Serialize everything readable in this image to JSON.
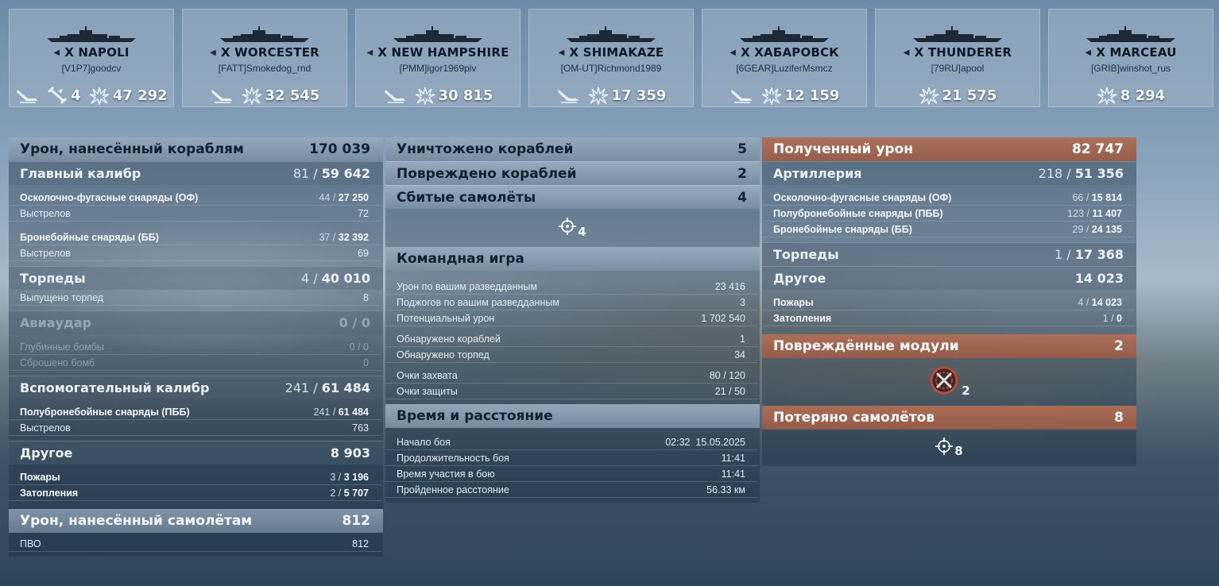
{
  "ships": [
    {
      "name": "X NAPOLI",
      "player": "[V1P7]goodcv",
      "stats": [
        {
          "icon": "torpedo-hit-icon",
          "value": ""
        },
        {
          "icon": "aircraft-kill-icon",
          "value": "4"
        },
        {
          "icon": "damage-icon",
          "value": "47 292"
        }
      ]
    },
    {
      "name": "X WORCESTER",
      "player": "[FATT]Smokedog_rnd",
      "stats": [
        {
          "icon": "torpedo-hit-icon",
          "value": ""
        },
        {
          "icon": "damage-icon",
          "value": "32 545"
        }
      ]
    },
    {
      "name": "X NEW HAMPSHIRE",
      "player": "[PMM]igor1969piv",
      "stats": [
        {
          "icon": "torpedo-hit-icon",
          "value": ""
        },
        {
          "icon": "damage-icon",
          "value": "30 815"
        }
      ]
    },
    {
      "name": "X SHIMAKAZE",
      "player": "[OM-UT]Richmond1989",
      "stats": [
        {
          "icon": "torpedo-hit-icon",
          "value": ""
        },
        {
          "icon": "damage-icon",
          "value": "17 359"
        }
      ]
    },
    {
      "name": "X ХАБАРОВСК",
      "player": "[6GEAR]LuziferMsmcz",
      "stats": [
        {
          "icon": "torpedo-hit-icon",
          "value": ""
        },
        {
          "icon": "damage-icon",
          "value": "12 159"
        }
      ]
    },
    {
      "name": "X THUNDERER",
      "player": "[79RU]apool",
      "stats": [
        {
          "icon": "damage-icon",
          "value": "21 575"
        }
      ]
    },
    {
      "name": "X MARCEAU",
      "player": "[GRIB]winshot_rus",
      "stats": [
        {
          "icon": "damage-icon",
          "value": "8 294"
        }
      ]
    }
  ],
  "left": {
    "damage_header": {
      "label": "Урон, нанесённый кораблям",
      "value": "170 039"
    },
    "main_battery": {
      "label": "Главный калибр",
      "hits": "81",
      "dmg": "59 642"
    },
    "he": {
      "label": "Осколочно-фугасные снаряды (ОФ)",
      "hits": "44",
      "dmg": "27 250"
    },
    "he_shots": {
      "label": "Выстрелов",
      "value": "72"
    },
    "ap": {
      "label": "Бронебойные снаряды (ББ)",
      "hits": "37",
      "dmg": "32 392"
    },
    "ap_shots": {
      "label": "Выстрелов",
      "value": "69"
    },
    "torpedoes": {
      "label": "Торпеды",
      "hits": "4",
      "dmg": "40 010"
    },
    "torp_launched": {
      "label": "Выпущено торпед",
      "value": "8"
    },
    "airstrike": {
      "label": "Авиаудар",
      "value": "0 / 0"
    },
    "depth": {
      "label": "Глубинные бомбы",
      "value": "0 / 0"
    },
    "bombs": {
      "label": "Сброшено бомб",
      "value": "0"
    },
    "secondary": {
      "label": "Вспомогательный калибр",
      "hits": "241",
      "dmg": "61 484"
    },
    "sap": {
      "label": "Полубронебойные снаряды (ПББ)",
      "hits": "241",
      "dmg": "61 484"
    },
    "sec_shots": {
      "label": "Выстрелов",
      "value": "763"
    },
    "other": {
      "label": "Другое",
      "value": "8 903"
    },
    "fires": {
      "label": "Пожары",
      "hits": "3",
      "dmg": "3 196"
    },
    "floods": {
      "label": "Затопления",
      "hits": "2",
      "dmg": "5 707"
    },
    "aa_header": {
      "label": "Урон, нанесённый самолётам",
      "value": "812"
    },
    "aa": {
      "label": "ПВО",
      "value": "812"
    }
  },
  "mid": {
    "destroyed": {
      "label": "Уничтожено кораблей",
      "value": "5"
    },
    "damaged": {
      "label": "Повреждено кораблей",
      "value": "2"
    },
    "planes_shot": {
      "label": "Сбитые самолёты",
      "value": "4"
    },
    "planes_icon_count": "4",
    "team_header": {
      "label": "Командная игра"
    },
    "spot_dmg": {
      "label": "Урон по вашим разведданным",
      "value": "23 416"
    },
    "spot_fires": {
      "label": "Поджогов по вашим разведданным",
      "value": "3"
    },
    "potential": {
      "label": "Потенциальный урон",
      "value": "1 702 540"
    },
    "ships_spotted": {
      "label": "Обнаружено кораблей",
      "value": "1"
    },
    "torps_spotted": {
      "label": "Обнаружено торпед",
      "value": "34"
    },
    "capture": {
      "label": "Очки захвата",
      "value": "80 / 120"
    },
    "defense": {
      "label": "Очки защиты",
      "value": "21 / 50"
    },
    "time_header": {
      "label": "Время и расстояние"
    },
    "start": {
      "label": "Начало боя",
      "value": "02:32  15.05.2025"
    },
    "duration": {
      "label": "Продолжительность боя",
      "value": "11:41"
    },
    "participation": {
      "label": "Время участия в бою",
      "value": "11:41"
    },
    "distance": {
      "label": "Пройденное расстояние",
      "value": "56.33 км"
    }
  },
  "right": {
    "received": {
      "label": "Полученный урон",
      "value": "82 747"
    },
    "artillery": {
      "label": "Артиллерия",
      "hits": "218",
      "dmg": "51 356"
    },
    "he": {
      "label": "Осколочно-фугасные снаряды (ОФ)",
      "hits": "66",
      "dmg": "15 814"
    },
    "sap": {
      "label": "Полубронебойные снаряды (ПББ)",
      "hits": "123",
      "dmg": "11 407"
    },
    "ap": {
      "label": "Бронебойные снаряды (ББ)",
      "hits": "29",
      "dmg": "24 135"
    },
    "torpedoes": {
      "label": "Торпеды",
      "hits": "1",
      "dmg": "17 368"
    },
    "other": {
      "label": "Другое",
      "value": "14 023"
    },
    "fires": {
      "label": "Пожары",
      "hits": "4",
      "dmg": "14 023"
    },
    "floods": {
      "label": "Затопления",
      "hits": "1",
      "dmg": "0"
    },
    "modules": {
      "label": "Повреждённые модули",
      "value": "2"
    },
    "modules_icon_count": "2",
    "planes_lost": {
      "label": "Потеряно самолётов",
      "value": "8"
    },
    "planes_lost_icon_count": "8"
  },
  "colors": {
    "accent_blue": "#8fa7bf",
    "accent_orange": "#a8684f"
  }
}
